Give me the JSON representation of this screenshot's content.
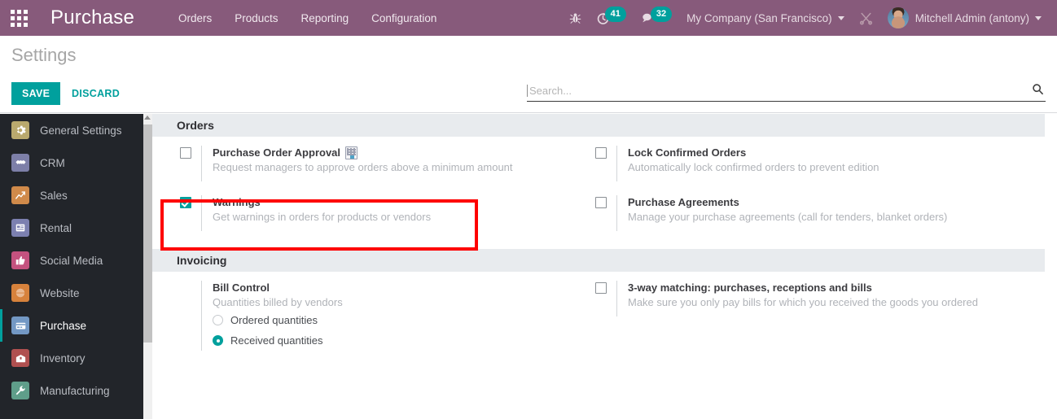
{
  "topbar": {
    "apps_icon": "apps-grid-icon",
    "brand": "Purchase",
    "menu": [
      {
        "label": "Orders"
      },
      {
        "label": "Products"
      },
      {
        "label": "Reporting"
      },
      {
        "label": "Configuration"
      }
    ],
    "bug_icon": "bug-icon",
    "activity_icon": "clock-activity-icon",
    "activity_count": "41",
    "messages_icon": "chat-bubble-icon",
    "messages_count": "32",
    "company": "My Company (San Francisco)",
    "tools_icon": "scissors-tools-icon",
    "user_name": "Mitchell Admin (antony)",
    "avatar_icon": "user-avatar"
  },
  "control_panel": {
    "title": "Settings",
    "save_label": "SAVE",
    "discard_label": "DISCARD"
  },
  "search": {
    "value": "",
    "placeholder": "Search...",
    "icon": "search-icon"
  },
  "sidebar": {
    "items": [
      {
        "label": "General Settings",
        "icon": "gear-icon",
        "color": "#b9a96e",
        "glyph": "⚙",
        "active": false
      },
      {
        "label": "CRM",
        "icon": "handshake-icon",
        "color": "#7d7fa8",
        "glyph": "✿",
        "active": false
      },
      {
        "label": "Sales",
        "icon": "chart-up-icon",
        "color": "#d08a4a",
        "glyph": "↗",
        "active": false
      },
      {
        "label": "Rental",
        "icon": "document-icon",
        "color": "#7c80b0",
        "glyph": "☰",
        "active": false
      },
      {
        "label": "Social Media",
        "icon": "thumbs-up-icon",
        "color": "#c4527f",
        "glyph": "☝",
        "active": false
      },
      {
        "label": "Website",
        "icon": "globe-icon",
        "color": "#d7823c",
        "glyph": "◔",
        "active": false
      },
      {
        "label": "Purchase",
        "icon": "credit-card-icon",
        "color": "#7398c4",
        "glyph": "▤",
        "active": true
      },
      {
        "label": "Inventory",
        "icon": "box-icon",
        "color": "#b05050",
        "glyph": "▦",
        "active": false
      },
      {
        "label": "Manufacturing",
        "icon": "wrench-icon",
        "color": "#5f9e8a",
        "glyph": "⚒",
        "active": false
      }
    ],
    "scrollbar": "sidebar-scrollbar"
  },
  "sections": [
    {
      "name": "orders",
      "heading": "Orders",
      "left": [
        {
          "key": "purchase-order-approval",
          "title": "Purchase Order Approval",
          "description": "Request managers to approve orders above a minimum amount",
          "checked": false,
          "enterprise_badge": true,
          "highlighted": false
        },
        {
          "key": "warnings",
          "title": "Warnings",
          "description": "Get warnings in orders for products or vendors",
          "checked": true,
          "enterprise_badge": false,
          "highlighted": true
        }
      ],
      "right": [
        {
          "key": "lock-confirmed-orders",
          "title": "Lock Confirmed Orders",
          "description": "Automatically lock confirmed orders to prevent edition",
          "checked": false,
          "enterprise_badge": false,
          "highlighted": false
        },
        {
          "key": "purchase-agreements",
          "title": "Purchase Agreements",
          "description": "Manage your purchase agreements (call for tenders, blanket orders)",
          "checked": false,
          "enterprise_badge": false,
          "highlighted": false
        }
      ]
    },
    {
      "name": "invoicing",
      "heading": "Invoicing",
      "left": [
        {
          "key": "bill-control",
          "title": "Bill Control",
          "description": "Quantities billed by vendors",
          "checkbox": false,
          "radios": [
            {
              "label": "Ordered quantities",
              "selected": false
            },
            {
              "label": "Received quantities",
              "selected": true
            }
          ]
        }
      ],
      "right": [
        {
          "key": "three-way-matching",
          "title": "3-way matching: purchases, receptions and bills",
          "description": "Make sure you only pay bills for which you received the goods you ordered",
          "checked": false,
          "enterprise_badge": false,
          "highlighted": false
        }
      ]
    }
  ],
  "annotation": {
    "highlight_color": "#fe0000",
    "target": "warnings"
  },
  "colors": {
    "topbar": "#875a7b",
    "accent": "#00a09d",
    "sidebar_bg": "#22252a",
    "section_header_bg": "#e8ebee"
  }
}
